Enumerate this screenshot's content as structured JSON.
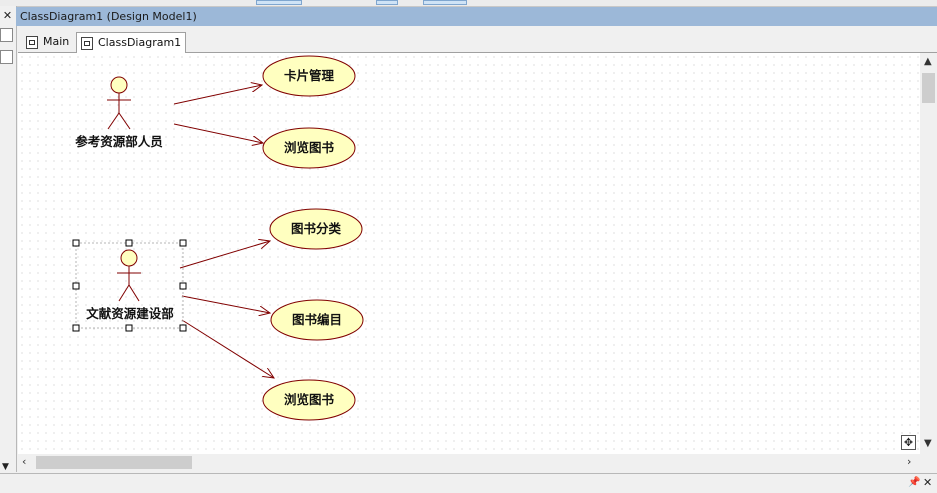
{
  "window": {
    "title": "ClassDiagram1 (Design Model1)"
  },
  "tabs": [
    {
      "label": "Main"
    },
    {
      "label": "ClassDiagram1"
    }
  ],
  "diagram": {
    "actors": [
      {
        "label": "参考资源部人员"
      },
      {
        "label": "文献资源建设部"
      }
    ],
    "use_cases": [
      {
        "label": "卡片管理"
      },
      {
        "label": "浏览图书"
      },
      {
        "label": "图书分类"
      },
      {
        "label": "图书编目"
      },
      {
        "label": "浏览图书"
      }
    ]
  },
  "colors": {
    "title_bar": "#9cb8d8",
    "use_case_fill": "#ffffc0",
    "actor_fill": "#ffffc0",
    "association_line": "#800000"
  },
  "icons": {
    "close": "close-icon",
    "diagram_tab": "diagram-icon",
    "navigator": "move-icon",
    "pin": "pin-icon"
  }
}
